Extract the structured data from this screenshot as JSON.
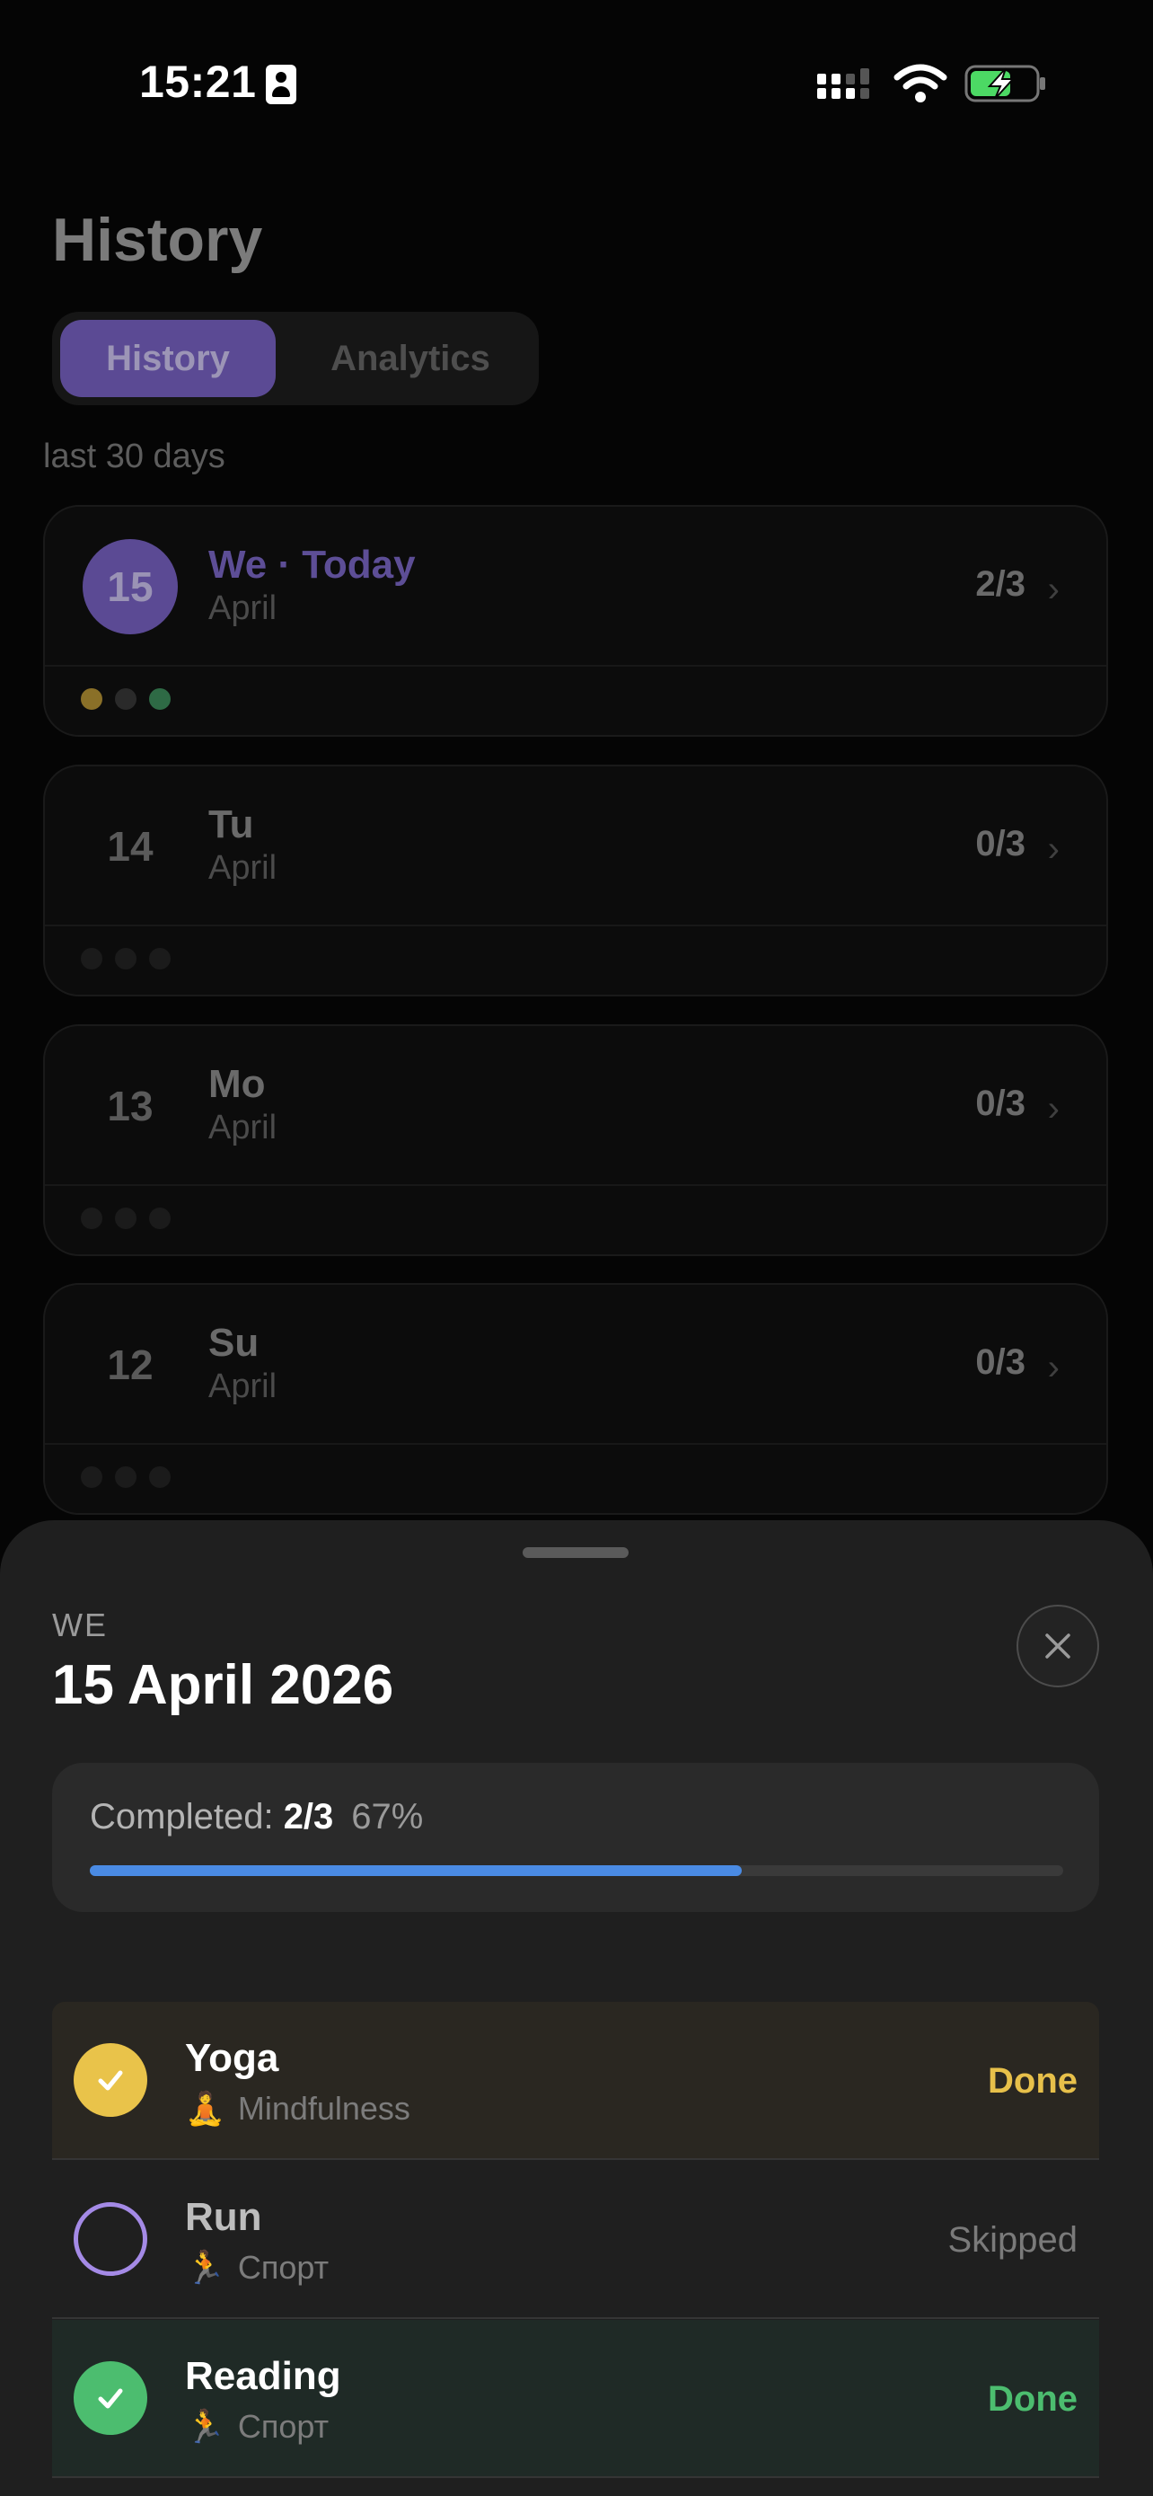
{
  "status_bar": {
    "time": "15:21"
  },
  "page": {
    "title": "History",
    "tabs": [
      {
        "label": "History",
        "active": true
      },
      {
        "label": "Analytics",
        "active": false
      }
    ],
    "range_label": "last 30 days"
  },
  "days": [
    {
      "num": "15",
      "name": "We · Today",
      "month": "April",
      "count": "2/3",
      "today": true,
      "dots": [
        "#8a7028",
        "#2a2a2a",
        "#2e6a45"
      ]
    },
    {
      "num": "14",
      "name": "Tu",
      "month": "April",
      "count": "0/3",
      "today": false,
      "dots": [
        "#1b1b1b",
        "#1b1b1b",
        "#1b1b1b"
      ]
    },
    {
      "num": "13",
      "name": "Mo",
      "month": "April",
      "count": "0/3",
      "today": false,
      "dots": [
        "#1b1b1b",
        "#1b1b1b",
        "#1b1b1b"
      ]
    },
    {
      "num": "12",
      "name": "Su",
      "month": "April",
      "count": "0/3",
      "today": false,
      "dots": [
        "#1b1b1b",
        "#1b1b1b",
        "#1b1b1b"
      ]
    }
  ],
  "sheet": {
    "weekday": "WE",
    "date": "15 April 2026",
    "progress": {
      "label": "Completed:",
      "fraction": "2/3",
      "percent": "67%",
      "value": 0.67
    },
    "tasks": [
      {
        "name": "Yoga",
        "emoji": "🧘",
        "category": "Mindfulness",
        "status": "Done"
      },
      {
        "name": "Run",
        "emoji": "🏃",
        "category": "Спорт",
        "status": "Skipped"
      },
      {
        "name": "Reading",
        "emoji": "🏃",
        "category": "Спорт",
        "status": "Done"
      }
    ]
  },
  "colors": {
    "accent": "#5b4a94",
    "progress": "#4a8be4",
    "done_yellow": "#e7c04a",
    "done_green": "#4cbd6f"
  }
}
